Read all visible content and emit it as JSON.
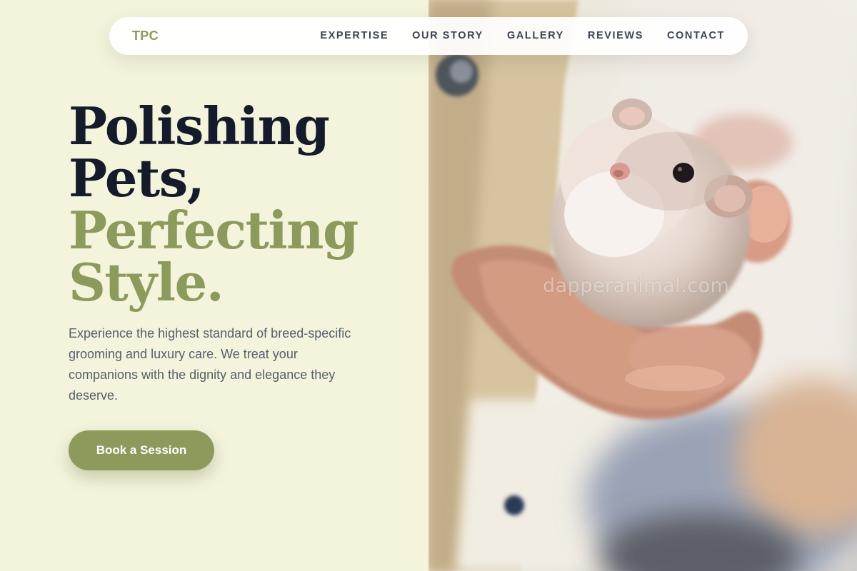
{
  "nav": {
    "logo": "TPC",
    "links": [
      "EXPERTISE",
      "OUR STORY",
      "GALLERY",
      "REVIEWS",
      "CONTACT"
    ]
  },
  "hero": {
    "title_lines": [
      "Polishing",
      "Pets,",
      "Perfecting",
      "Style."
    ],
    "description": "Experience the highest standard of breed-specific grooming and luxury care. We treat your companions with the dignity and elegance they deserve.",
    "cta_label": "Book a Session"
  },
  "photo": {
    "watermark": "dapperanimal.com"
  },
  "colors": {
    "background": "#f4f3dc",
    "accent": "#8c9a5b",
    "heading": "#151b2b",
    "body_text": "#55606c"
  },
  "icons": [
    "hamster-photo"
  ]
}
